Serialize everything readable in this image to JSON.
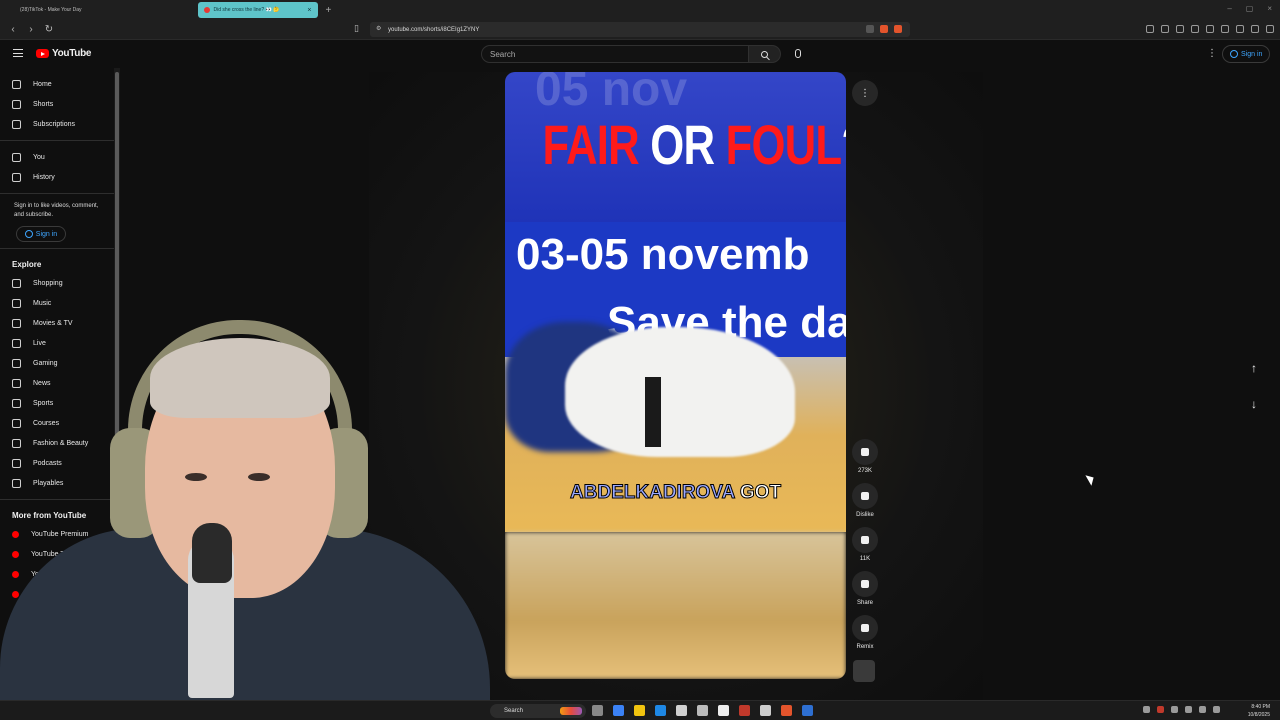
{
  "browser": {
    "tabs": [
      {
        "label": "(28)TikTok - Make Your Day",
        "active": false
      },
      {
        "label": "Did she cross the line? 👀 🤔",
        "active": true
      }
    ],
    "url": "youtube.com/shorts/i8CEIg1ZYNY",
    "colors": {
      "active_tab": "#5ec4c9"
    }
  },
  "youtube": {
    "logo_text": "YouTube",
    "search_placeholder": "Search",
    "signin_label": "Sign in",
    "colors": {
      "brand_red": "#ff0000",
      "link_blue": "#3ea6ff"
    }
  },
  "sidebar": {
    "main": [
      {
        "label": "Home",
        "icon": "home-icon"
      },
      {
        "label": "Shorts",
        "icon": "shorts-icon"
      },
      {
        "label": "Subscriptions",
        "icon": "subscriptions-icon"
      }
    ],
    "you": [
      {
        "label": "You",
        "icon": "you-icon"
      },
      {
        "label": "History",
        "icon": "history-icon"
      }
    ],
    "signin_note": "Sign in to like videos, comment, and subscribe.",
    "signin_label": "Sign in",
    "explore_title": "Explore",
    "explore": [
      {
        "label": "Shopping",
        "icon": "shopping-icon"
      },
      {
        "label": "Music",
        "icon": "music-icon"
      },
      {
        "label": "Movies & TV",
        "icon": "movies-icon"
      },
      {
        "label": "Live",
        "icon": "live-icon"
      },
      {
        "label": "Gaming",
        "icon": "gaming-icon"
      },
      {
        "label": "News",
        "icon": "news-icon"
      },
      {
        "label": "Sports",
        "icon": "sports-icon"
      },
      {
        "label": "Courses",
        "icon": "courses-icon"
      },
      {
        "label": "Fashion & Beauty",
        "icon": "fashion-icon"
      },
      {
        "label": "Podcasts",
        "icon": "podcasts-icon"
      },
      {
        "label": "Playables",
        "icon": "playables-icon"
      }
    ],
    "more_title": "More from YouTube",
    "more": [
      {
        "label": "YouTube Premium",
        "icon": "youtube-premium-icon"
      },
      {
        "label": "YouTube TV",
        "icon": "youtube-tv-icon"
      },
      {
        "label": "YouTube M",
        "icon": "youtube-music-icon"
      },
      {
        "label": "Yo",
        "icon": "youtube-kids-icon"
      }
    ]
  },
  "short": {
    "headline_red_1": "FAIR",
    "headline_white": " OR ",
    "headline_red_2": "FOUL",
    "headline_q": "?",
    "date_text": "03-05 novemb",
    "save_text": "Save the da",
    "caption_1": "ABDELKADIROVA",
    "caption_2": " GOT",
    "colors": {
      "headline_red": "#ff1a1a",
      "banner_blue": "#1c39c4",
      "caption_blue": "#9aa8ff"
    }
  },
  "actions": [
    {
      "name": "like",
      "label": "273K",
      "icon": "thumbs-up-icon"
    },
    {
      "name": "dislike",
      "label": "Dislike",
      "icon": "thumbs-down-icon"
    },
    {
      "name": "comments",
      "label": "11K",
      "icon": "comment-icon"
    },
    {
      "name": "share",
      "label": "Share",
      "icon": "share-icon"
    },
    {
      "name": "remix",
      "label": "Remix",
      "icon": "remix-icon"
    }
  ],
  "taskbar": {
    "search_label": "Search",
    "clock_time": "8:40 PM",
    "clock_date": "10/8/2025"
  }
}
